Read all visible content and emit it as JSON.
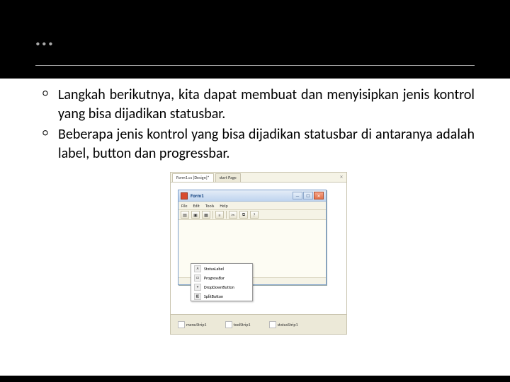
{
  "header": {
    "ellipsis": "…"
  },
  "bullets": [
    "Langkah berikutnya, kita dapat membuat dan menyisipkan jenis kontrol yang bisa dijadikan statusbar.",
    "Beberapa jenis kontrol yang bisa dijadikan statusbar di antaranya adalah label, button dan progressbar."
  ],
  "ide": {
    "tabs": {
      "active": "Form1.cs [Design]*",
      "inactive": "start Page"
    },
    "form": {
      "title": "Form1",
      "menu": [
        "File",
        "Edit",
        "Tools",
        "Help"
      ],
      "win_min": "—",
      "win_max": "☐",
      "win_close": "✕"
    },
    "contextmenu": [
      "StatusLabel",
      "ProgressBar",
      "DropDownButton",
      "SplitButton"
    ],
    "tray": [
      {
        "label": "menuStrip1"
      },
      {
        "label": "toolStrip1"
      },
      {
        "label": "statusStrip1"
      }
    ]
  }
}
